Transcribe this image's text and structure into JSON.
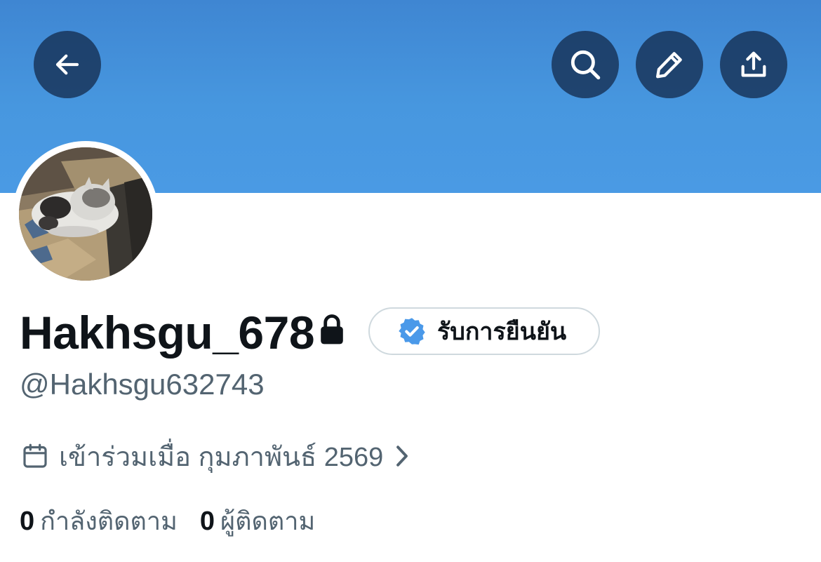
{
  "header": {
    "back_icon": "arrow-left-icon",
    "search_icon": "search-icon",
    "edit_icon": "pencil-icon",
    "share_icon": "share-upload-icon",
    "banner_color": "#4797df",
    "button_bg": "#1e3a5f"
  },
  "profile": {
    "display_name": "Hakhsgu_678",
    "protected_icon": "lock-icon",
    "verify_button_label": "รับการยืนยัน",
    "verify_badge_icon": "verified-badge-icon",
    "verify_badge_color": "#4a99e9",
    "handle": "@Hakhsgu632743",
    "joined_icon": "calendar-icon",
    "joined_text": "เข้าร่วมเมื่อ กุมภาพันธ์ 2569",
    "joined_chevron_icon": "chevron-right-icon"
  },
  "stats": {
    "following_count": "0",
    "following_label": "กำลังติดตาม",
    "followers_count": "0",
    "followers_label": "ผู้ติดตาม"
  }
}
